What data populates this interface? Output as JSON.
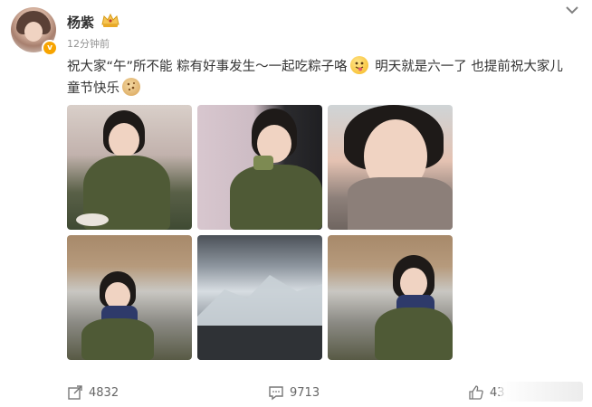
{
  "header": {
    "username": "杨紫",
    "timestamp": "12分钟前",
    "verified_icon": "verified-badge-icon",
    "vip_icon": "crown-icon",
    "more_icon": "chevron-down-icon"
  },
  "post": {
    "line1_part1": "祝大家“午”所不能 粽有好事发生～一起吃粽子咯",
    "line1_part2": "明天就是六一了 也提前祝大家儿",
    "line2": "童节快乐"
  },
  "photos": [
    {
      "name": "photo-1"
    },
    {
      "name": "photo-2"
    },
    {
      "name": "photo-3"
    },
    {
      "name": "photo-4"
    },
    {
      "name": "photo-5"
    },
    {
      "name": "photo-6"
    }
  ],
  "actions": {
    "share_count": "4832",
    "comment_count": "9713",
    "like_count": "43"
  },
  "colors": {
    "accent": "#f7a400",
    "text": "#333333",
    "muted": "#939393"
  }
}
